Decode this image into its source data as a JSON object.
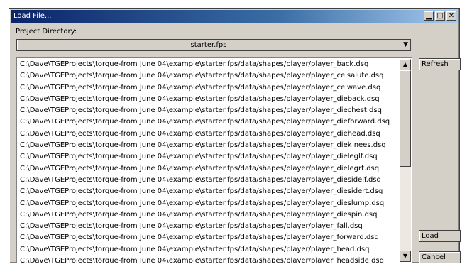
{
  "window": {
    "title": "Load File...",
    "controls": {
      "minimize": "▁",
      "maximize": "□",
      "close": "✕"
    }
  },
  "project_directory": {
    "label": "Project Directory:",
    "selected": "starter.fps"
  },
  "buttons": {
    "refresh": "Refresh",
    "load": "Load",
    "cancel": "Cancel"
  },
  "files": [
    "C:\\Dave\\TGEProjects\\torque-from June 04\\example\\starter.fps/data/shapes/player/player_back.dsq",
    "C:\\Dave\\TGEProjects\\torque-from June 04\\example\\starter.fps/data/shapes/player/player_celsalute.dsq",
    "C:\\Dave\\TGEProjects\\torque-from June 04\\example\\starter.fps/data/shapes/player/player_celwave.dsq",
    "C:\\Dave\\TGEProjects\\torque-from June 04\\example\\starter.fps/data/shapes/player/player_dieback.dsq",
    "C:\\Dave\\TGEProjects\\torque-from June 04\\example\\starter.fps/data/shapes/player/player_diechest.dsq",
    "C:\\Dave\\TGEProjects\\torque-from June 04\\example\\starter.fps/data/shapes/player/player_dieforward.dsq",
    "C:\\Dave\\TGEProjects\\torque-from June 04\\example\\starter.fps/data/shapes/player/player_diehead.dsq",
    "C:\\Dave\\TGEProjects\\torque-from June 04\\example\\starter.fps/data/shapes/player/player_diek nees.dsq",
    "C:\\Dave\\TGEProjects\\torque-from June 04\\example\\starter.fps/data/shapes/player/player_dieleglf.dsq",
    "C:\\Dave\\TGEProjects\\torque-from June 04\\example\\starter.fps/data/shapes/player/player_dielegrt.dsq",
    "C:\\Dave\\TGEProjects\\torque-from June 04\\example\\starter.fps/data/shapes/player/player_diesidelf.dsq",
    "C:\\Dave\\TGEProjects\\torque-from June 04\\example\\starter.fps/data/shapes/player/player_diesidert.dsq",
    "C:\\Dave\\TGEProjects\\torque-from June 04\\example\\starter.fps/data/shapes/player/player_dieslump.dsq",
    "C:\\Dave\\TGEProjects\\torque-from June 04\\example\\starter.fps/data/shapes/player/player_diespin.dsq",
    "C:\\Dave\\TGEProjects\\torque-from June 04\\example\\starter.fps/data/shapes/player/player_fall.dsq",
    "C:\\Dave\\TGEProjects\\torque-from June 04\\example\\starter.fps/data/shapes/player/player_forward.dsq",
    "C:\\Dave\\TGEProjects\\torque-from June 04\\example\\starter.fps/data/shapes/player/player_head.dsq",
    "C:\\Dave\\TGEProjects\\torque-from June 04\\example\\starter.fps/data/shapes/player/player_headside.dsq"
  ],
  "scrollbar": {
    "up_icon": "▲",
    "down_icon": "▼"
  },
  "dropdown_icon": "▼"
}
